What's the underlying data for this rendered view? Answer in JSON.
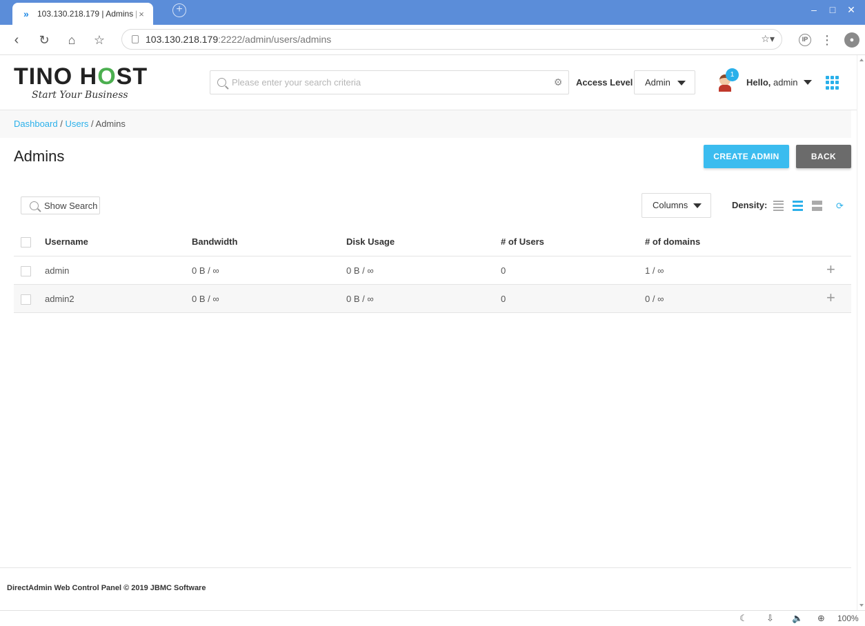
{
  "browser": {
    "tab_title": "103.130.218.179 | Admins |",
    "close_glyph": "×",
    "new_tab_glyph": "+",
    "url_host": "103.130.218.179",
    "url_path": ":2222/admin/users/admins",
    "ext_ip_label": "IP",
    "zoom": "100%"
  },
  "header": {
    "logo_text_start": "TINO H",
    "logo_text_o": "O",
    "logo_text_end": "ST",
    "logo_tagline": "Start Your Business",
    "search_placeholder": "Please enter your search criteria",
    "access_level_label": "Access Level",
    "access_level_value": "Admin",
    "notification_count": "1",
    "greeting": "Hello,",
    "username": "admin",
    "accent_color": "#2ab0ea"
  },
  "breadcrumb": {
    "items": [
      "Dashboard",
      "Users",
      "Admins"
    ],
    "separator": " / "
  },
  "page": {
    "title": "Admins",
    "create_label": "Create Admin",
    "back_label": "BACK"
  },
  "toolbar": {
    "show_search_label": "Show Search",
    "columns_label": "Columns",
    "density_label": "Density:"
  },
  "table": {
    "columns": [
      "Username",
      "Bandwidth",
      "Disk Usage",
      "# of Users",
      "# of domains"
    ],
    "rows": [
      [
        "admin",
        "0 B / ∞",
        "0 B / ∞",
        "0",
        "1 / ∞"
      ],
      [
        "admin2",
        "0 B / ∞",
        "0 B / ∞",
        "0",
        "0 / ∞"
      ]
    ]
  },
  "footer": {
    "text": "DirectAdmin Web Control Panel © 2019 JBMC Software"
  }
}
